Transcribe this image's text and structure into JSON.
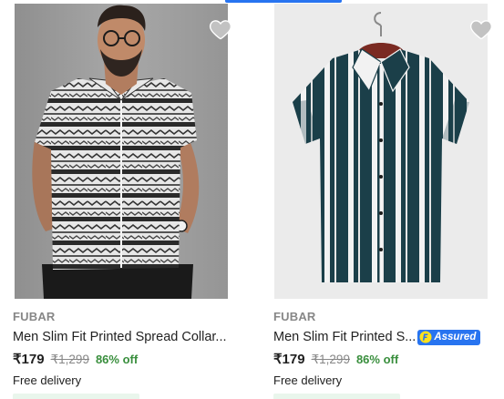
{
  "colors": {
    "accent": "#2874f0",
    "discount": "#388e3c",
    "brand_text": "#878787",
    "wishlist_icon": "#c2c2c2"
  },
  "products": [
    {
      "brand": "FUBAR",
      "title": "Men Slim Fit Printed Spread Collar...",
      "price": "₹179",
      "mrp": "₹1,299",
      "discount": "86% off",
      "delivery": "Free delivery",
      "image_icon": "patterned-shirt-model-photo",
      "wishlist_icon": "heart-icon"
    },
    {
      "brand": "FUBAR",
      "title": "Men Slim Fit Printed S...",
      "assured_label": "Assured",
      "assured_icon": "flipkart-f-icon",
      "price": "₹179",
      "mrp": "₹1,299",
      "discount": "86% off",
      "delivery": "Free delivery",
      "image_icon": "striped-shirt-on-hanger-photo",
      "wishlist_icon": "heart-icon"
    }
  ]
}
